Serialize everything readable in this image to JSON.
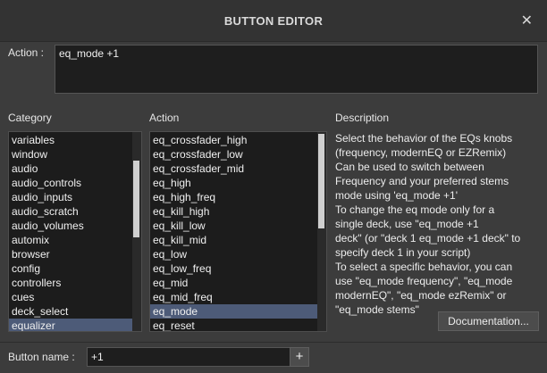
{
  "window": {
    "title": "BUTTON EDITOR",
    "close_glyph": "✕"
  },
  "action": {
    "label": "Action :",
    "value": "eq_mode +1"
  },
  "category": {
    "header": "Category",
    "items": [
      "variables",
      "window",
      "audio",
      "audio_controls",
      "audio_inputs",
      "audio_scratch",
      "audio_volumes",
      "automix",
      "browser",
      "config",
      "controllers",
      "cues",
      "deck_select",
      "equalizer"
    ],
    "selected": "equalizer"
  },
  "action_list": {
    "header": "Action",
    "items": [
      "eq_crossfader_high",
      "eq_crossfader_low",
      "eq_crossfader_mid",
      "eq_high",
      "eq_high_freq",
      "eq_kill_high",
      "eq_kill_low",
      "eq_kill_mid",
      "eq_low",
      "eq_low_freq",
      "eq_mid",
      "eq_mid_freq",
      "eq_mode",
      "eq_reset"
    ],
    "selected": "eq_mode"
  },
  "description": {
    "header": "Description",
    "lines": [
      "Select the behavior of the EQs knobs",
      "(frequency, modernEQ or EZRemix)",
      "Can be used to switch between",
      "Frequency and your preferred stems",
      "mode using 'eq_mode +1'",
      "To change the eq mode only for a",
      "single deck, use \"eq_mode +1",
      "deck\" (or \"deck 1 eq_mode +1 deck\" to",
      "specify deck 1 in your script)",
      "To select a specific behavior, you can",
      "use \"eq_mode frequency\", \"eq_mode",
      "modernEQ\", \"eq_mode ezRemix\" or",
      "\"eq_mode stems\""
    ],
    "documentation_button": "Documentation..."
  },
  "button_name": {
    "label": "Button name :",
    "value": "+1",
    "add_glyph": "+"
  },
  "colors": {
    "background": "#3c3c3c",
    "list_background": "#1c1c1c",
    "selection": "#4d5b78"
  }
}
